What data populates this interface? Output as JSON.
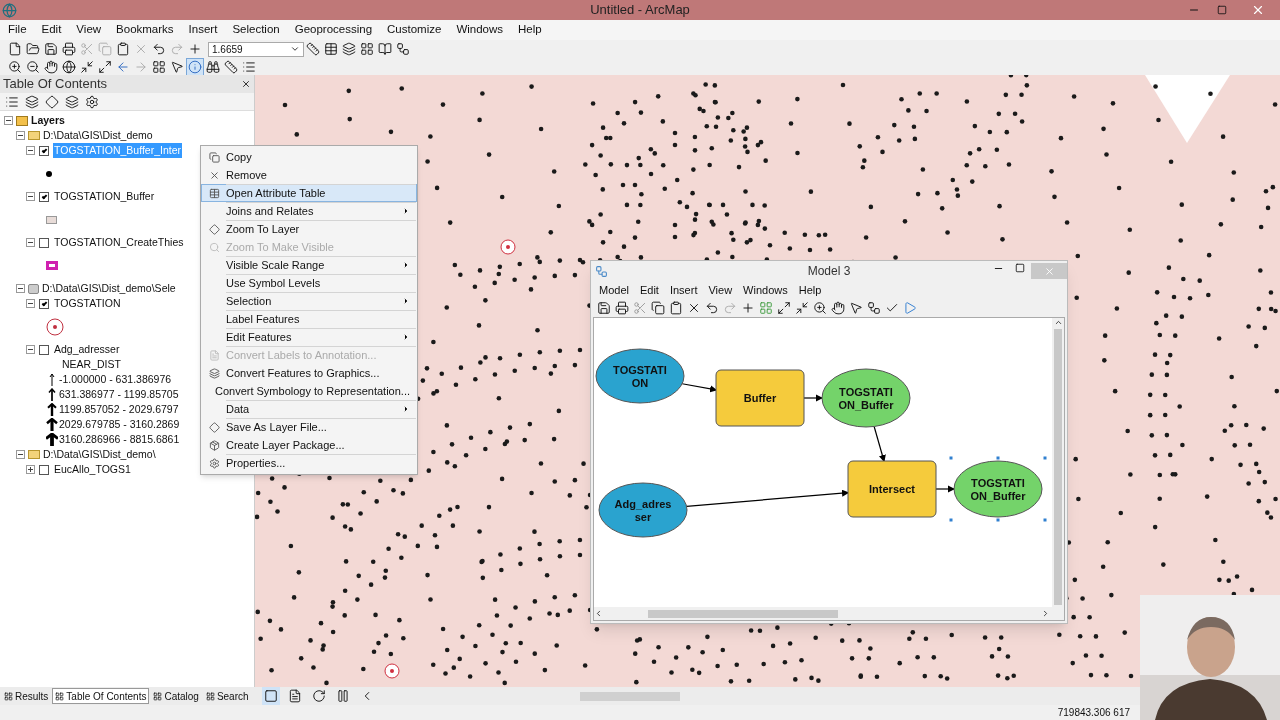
{
  "window": {
    "title": "Untitled - ArcMap"
  },
  "menu": [
    "File",
    "Edit",
    "View",
    "Bookmarks",
    "Insert",
    "Selection",
    "Geoprocessing",
    "Customize",
    "Windows",
    "Help"
  ],
  "scale_field": {
    "value": "1.6659"
  },
  "toc": {
    "title": "Table Of Contents",
    "root": {
      "label": "Layers",
      "expanded": true,
      "children": [
        {
          "kind": "folder",
          "label": "D:\\Data\\GIS\\Dist_demo",
          "expanded": true,
          "children": [
            {
              "label": "TOGSTATION_Buffer_Inter",
              "checked": true,
              "selected": true,
              "expanded": true,
              "symbol": {
                "kind": "dot"
              }
            },
            {
              "label": "TOGSTATION_Buffer",
              "checked": true,
              "selected": false,
              "expanded": true,
              "symbol": {
                "kind": "fill"
              }
            },
            {
              "label": "TOGSTATION_CreateThies",
              "checked": false,
              "selected": false,
              "expanded": true,
              "symbol": {
                "kind": "magenta"
              }
            }
          ]
        },
        {
          "kind": "database",
          "label": "D:\\Data\\GIS\\Dist_demo\\Sele",
          "expanded": true,
          "children": [
            {
              "label": "TOGSTATION",
              "checked": true,
              "selected": false,
              "expanded": true,
              "symbol": {
                "kind": "star"
              }
            },
            {
              "label": "Adg_adresser",
              "checked": false,
              "selected": false,
              "expanded": true,
              "field": "NEAR_DIST",
              "classes": [
                "-1.000000 - 631.386976",
                "631.386977 - 1199.85705",
                "1199.857052 - 2029.6797",
                "2029.679785 - 3160.2869",
                "3160.286966 - 8815.6861"
              ]
            }
          ]
        },
        {
          "kind": "folder",
          "label": "D:\\Data\\GIS\\Dist_demo\\",
          "expanded": true,
          "children": [
            {
              "label": "EucAllo_TOGS1",
              "checked": false,
              "selected": false,
              "expanded": false
            }
          ]
        }
      ]
    }
  },
  "context_menu": [
    {
      "label": "Copy",
      "disabled": false,
      "selected": false,
      "submenu": false,
      "divider_above": false
    },
    {
      "label": "Remove",
      "disabled": false,
      "selected": false,
      "submenu": false,
      "divider_above": false
    },
    {
      "label": "Open Attribute Table",
      "disabled": false,
      "selected": true,
      "submenu": false,
      "divider_above": true
    },
    {
      "label": "Joins and Relates",
      "disabled": false,
      "selected": false,
      "submenu": true,
      "divider_above": true
    },
    {
      "label": "Zoom To Layer",
      "disabled": false,
      "selected": false,
      "submenu": false,
      "divider_above": true
    },
    {
      "label": "Zoom To Make Visible",
      "disabled": true,
      "selected": false,
      "submenu": false,
      "divider_above": false
    },
    {
      "label": "Visible Scale Range",
      "disabled": false,
      "selected": false,
      "submenu": true,
      "divider_above": true
    },
    {
      "label": "Use Symbol Levels",
      "disabled": false,
      "selected": false,
      "submenu": false,
      "divider_above": true
    },
    {
      "label": "Selection",
      "disabled": false,
      "selected": false,
      "submenu": true,
      "divider_above": true
    },
    {
      "label": "Label Features",
      "disabled": false,
      "selected": false,
      "submenu": false,
      "divider_above": true
    },
    {
      "label": "Edit Features",
      "disabled": false,
      "selected": false,
      "submenu": true,
      "divider_above": true
    },
    {
      "label": "Convert Labels to Annotation...",
      "disabled": true,
      "selected": false,
      "submenu": false,
      "divider_above": true
    },
    {
      "label": "Convert Features to Graphics...",
      "disabled": false,
      "selected": false,
      "submenu": false,
      "divider_above": false
    },
    {
      "label": "Convert Symbology to Representation...",
      "disabled": false,
      "selected": false,
      "submenu": false,
      "divider_above": false
    },
    {
      "label": "Data",
      "disabled": false,
      "selected": false,
      "submenu": true,
      "divider_above": true
    },
    {
      "label": "Save As Layer File...",
      "disabled": false,
      "selected": false,
      "submenu": false,
      "divider_above": true
    },
    {
      "label": "Create Layer Package...",
      "disabled": false,
      "selected": false,
      "submenu": false,
      "divider_above": false
    },
    {
      "label": "Properties...",
      "disabled": false,
      "selected": false,
      "submenu": false,
      "divider_above": true
    }
  ],
  "model_window": {
    "title": "Model 3",
    "menu": [
      "Model",
      "Edit",
      "Insert",
      "View",
      "Windows",
      "Help"
    ],
    "nodes": [
      {
        "kind": "input",
        "label": "TOGSTATI ON",
        "selected": false
      },
      {
        "kind": "tool",
        "label": "Buffer",
        "selected": false
      },
      {
        "kind": "output",
        "label": "TOGSTATI ON_Buffer",
        "selected": false
      },
      {
        "kind": "tool",
        "label": "Intersect",
        "selected": false
      },
      {
        "kind": "input",
        "label": "Adg_adres ser",
        "selected": false
      },
      {
        "kind": "output",
        "label": "TOGSTATI ON_Buffer",
        "selected": true
      }
    ]
  },
  "bottom_tabs": [
    {
      "label": "Results",
      "selected": false
    },
    {
      "label": "Table Of Contents",
      "selected": true
    },
    {
      "label": "Catalog",
      "selected": false
    },
    {
      "label": "Search",
      "selected": false
    }
  ],
  "status_bar": {
    "coordinates": "719843.306 617"
  }
}
